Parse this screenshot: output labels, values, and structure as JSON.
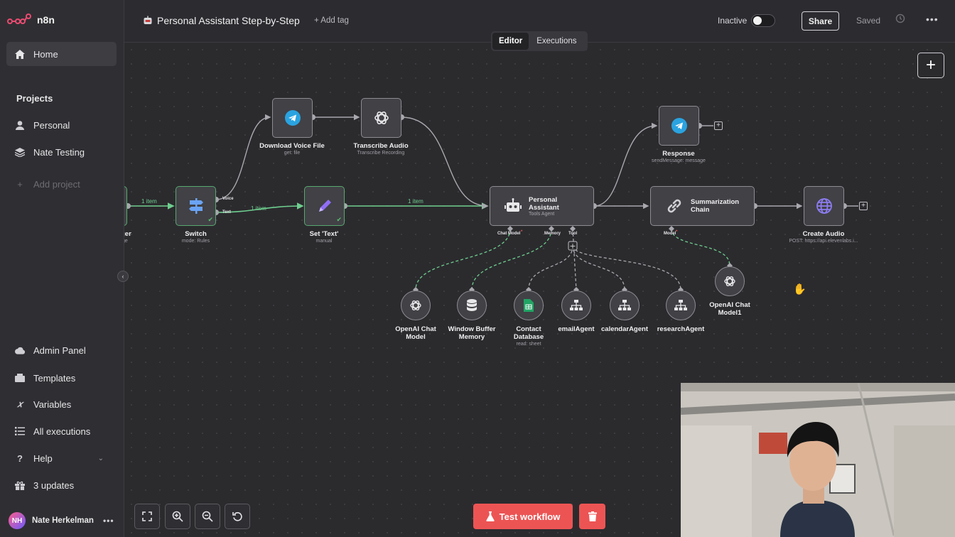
{
  "app": {
    "logo_text": "n8n",
    "accent_color": "#ec5454",
    "success_color": "#58a96e"
  },
  "sidebar": {
    "home": "Home",
    "projects_title": "Projects",
    "personal": "Personal",
    "nate_testing": "Nate Testing",
    "add_project": "Add project",
    "admin_panel": "Admin Panel",
    "templates": "Templates",
    "variables": "Variables",
    "all_executions": "All executions",
    "help": "Help",
    "updates": "3 updates",
    "user_initials": "NH",
    "user_name": "Nate Herkelman"
  },
  "header": {
    "workflow_title": "Personal Assistant Step-by-Step",
    "add_tag": "+ Add tag",
    "status_label": "Inactive",
    "active": false,
    "share": "Share",
    "saved": "Saved",
    "tab_editor": "Editor",
    "tab_executions": "Executions"
  },
  "nodes": {
    "trigger": {
      "label": "ger",
      "sub": "ge"
    },
    "switch": {
      "label": "Switch",
      "sub": "mode: Rules",
      "out_voice": "Voice",
      "out_text": "Text",
      "icon": "signpost-icon"
    },
    "download": {
      "label": "Download Voice File",
      "sub": "get: file",
      "icon": "telegram-icon"
    },
    "transcribe": {
      "label": "Transcribe Audio",
      "sub": "Transcribe Recording",
      "icon": "openai-icon"
    },
    "set_text": {
      "label": "Set 'Text'",
      "sub": "manual",
      "icon": "pencil-icon"
    },
    "agent": {
      "label1": "Personal",
      "label2": "Assistant",
      "sub": "Tools Agent",
      "port_chat": "Chat Model",
      "port_memory": "Memory",
      "port_tool": "Tool",
      "icon": "robot-icon"
    },
    "response": {
      "label": "Response",
      "sub": "sendMessage: message",
      "icon": "telegram-icon"
    },
    "summarization": {
      "label1": "Summarization",
      "label2": "Chain",
      "port_model": "Model",
      "icon": "link-icon"
    },
    "create_audio": {
      "label": "Create Audio",
      "sub": "POST: https://api.elevenlabs.i...",
      "icon": "globe-icon"
    },
    "openai_chat": {
      "label1": "OpenAI Chat",
      "label2": "Model"
    },
    "window_buffer": {
      "label1": "Window Buffer",
      "label2": "Memory"
    },
    "contact_db": {
      "label1": "Contact",
      "label2": "Database",
      "sub": "read: sheet"
    },
    "email_agent": {
      "label": "emailAgent"
    },
    "calendar_agent": {
      "label": "calendarAgent"
    },
    "research_agent": {
      "label": "researchAgent"
    },
    "openai_chat1": {
      "label1": "OpenAI Chat",
      "label2": "Model1"
    }
  },
  "edges": {
    "e1": "1 item",
    "e2": "1 item",
    "e3": "1 item"
  },
  "toolbar": {
    "test_workflow": "Test workflow"
  }
}
